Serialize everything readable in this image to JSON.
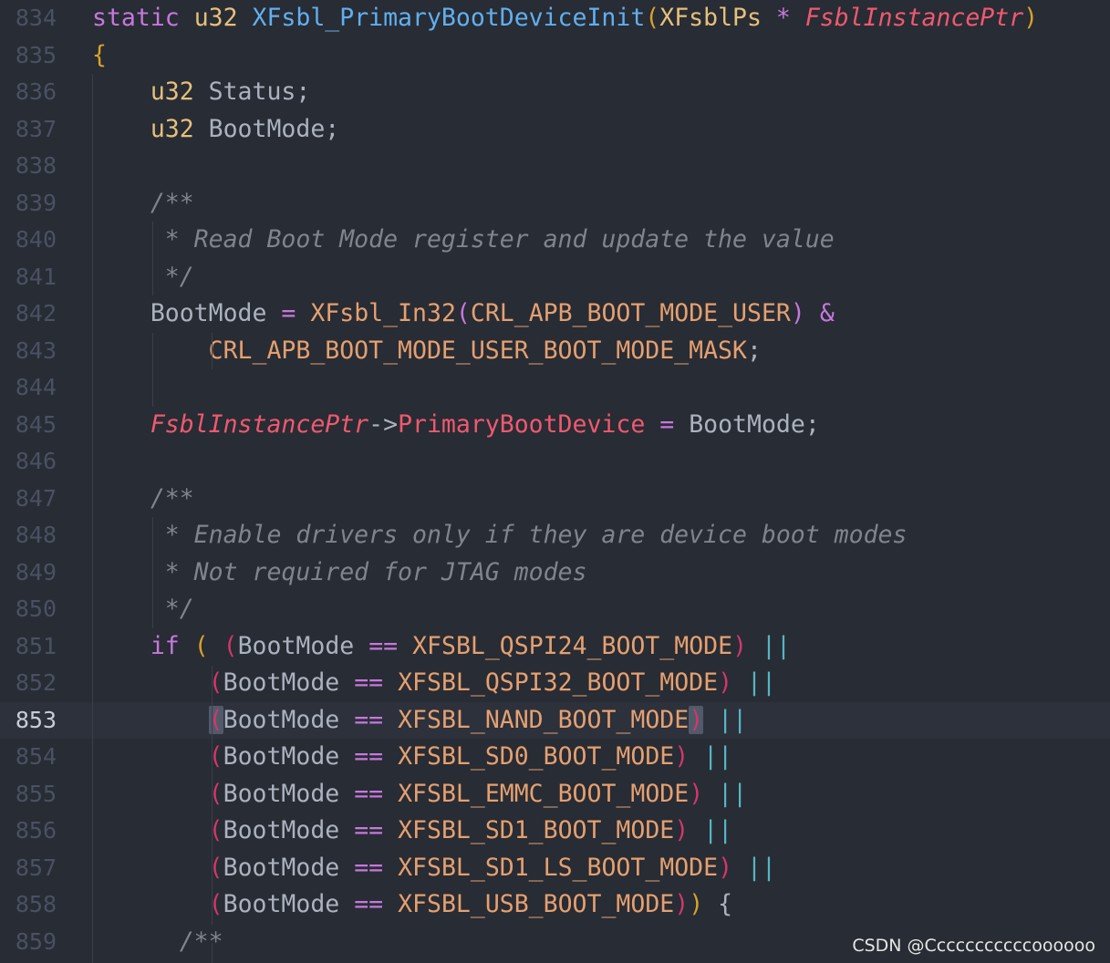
{
  "editor": {
    "active_line": "853",
    "lines": [
      {
        "num": "834",
        "tokens": [
          {
            "t": "static ",
            "c": "kw"
          },
          {
            "t": "u32 ",
            "c": "ty"
          },
          {
            "t": "XFsbl_PrimaryBootDeviceInit",
            "c": "fn"
          },
          {
            "t": "(",
            "c": "p1"
          },
          {
            "t": "XFsblPs",
            "c": "ty"
          },
          {
            "t": " * ",
            "c": "kw"
          },
          {
            "t": "FsblInstancePtr",
            "c": "param"
          },
          {
            "t": ")",
            "c": "p1"
          }
        ]
      },
      {
        "num": "835",
        "tokens": [
          {
            "t": "{",
            "c": "p1"
          }
        ]
      },
      {
        "num": "836",
        "tokens": [
          {
            "t": "    u32 ",
            "c": "ty"
          },
          {
            "t": "Status;",
            "c": "pl"
          }
        ]
      },
      {
        "num": "837",
        "tokens": [
          {
            "t": "    u32 ",
            "c": "ty"
          },
          {
            "t": "BootMode;",
            "c": "pl"
          }
        ]
      },
      {
        "num": "838",
        "tokens": []
      },
      {
        "num": "839",
        "tokens": [
          {
            "t": "    /**",
            "c": "cm"
          }
        ]
      },
      {
        "num": "840",
        "tokens": [
          {
            "t": "     * Read Boot Mode register and update the value",
            "c": "cm"
          }
        ]
      },
      {
        "num": "841",
        "tokens": [
          {
            "t": "     */",
            "c": "cm"
          }
        ]
      },
      {
        "num": "842",
        "tokens": [
          {
            "t": "    BootMode ",
            "c": "pl"
          },
          {
            "t": "=",
            "c": "op"
          },
          {
            "t": " ",
            "c": "pl"
          },
          {
            "t": "XFsbl_In32",
            "c": "mac"
          },
          {
            "t": "(",
            "c": "p2"
          },
          {
            "t": "CRL_APB_BOOT_MODE_USER",
            "c": "mac"
          },
          {
            "t": ")",
            "c": "p2"
          },
          {
            "t": " ",
            "c": "pl"
          },
          {
            "t": "&",
            "c": "op"
          }
        ]
      },
      {
        "num": "843",
        "tokens": [
          {
            "t": "        CRL_APB_BOOT_MODE_USER_BOOT_MODE_MASK",
            "c": "mac"
          },
          {
            "t": ";",
            "c": "pl"
          }
        ]
      },
      {
        "num": "844",
        "tokens": []
      },
      {
        "num": "845",
        "tokens": [
          {
            "t": "    FsblInstancePtr",
            "c": "param"
          },
          {
            "t": "->",
            "c": "pl"
          },
          {
            "t": "PrimaryBootDevice",
            "c": "mem"
          },
          {
            "t": " ",
            "c": "pl"
          },
          {
            "t": "=",
            "c": "op"
          },
          {
            "t": " BootMode;",
            "c": "pl"
          }
        ]
      },
      {
        "num": "846",
        "tokens": []
      },
      {
        "num": "847",
        "tokens": [
          {
            "t": "    /**",
            "c": "cm"
          }
        ]
      },
      {
        "num": "848",
        "tokens": [
          {
            "t": "     * Enable drivers only if they are device boot modes",
            "c": "cm"
          }
        ]
      },
      {
        "num": "849",
        "tokens": [
          {
            "t": "     * Not required for JTAG modes",
            "c": "cm"
          }
        ]
      },
      {
        "num": "850",
        "tokens": [
          {
            "t": "     */",
            "c": "cm"
          }
        ]
      },
      {
        "num": "851",
        "tokens": [
          {
            "t": "    if ",
            "c": "kw"
          },
          {
            "t": "(",
            "c": "p1"
          },
          {
            "t": " ",
            "c": "pl"
          },
          {
            "t": "(",
            "c": "p3"
          },
          {
            "t": "BootMode ",
            "c": "pl"
          },
          {
            "t": "==",
            "c": "op"
          },
          {
            "t": " ",
            "c": "pl"
          },
          {
            "t": "XFSBL_QSPI24_BOOT_MODE",
            "c": "mac"
          },
          {
            "t": ")",
            "c": "p3"
          },
          {
            "t": " ",
            "c": "pl"
          },
          {
            "t": "||",
            "c": "op2"
          }
        ]
      },
      {
        "num": "852",
        "tokens": [
          {
            "t": "        ",
            "c": "pl"
          },
          {
            "t": "(",
            "c": "p3"
          },
          {
            "t": "BootMode ",
            "c": "pl"
          },
          {
            "t": "==",
            "c": "op"
          },
          {
            "t": " ",
            "c": "pl"
          },
          {
            "t": "XFSBL_QSPI32_BOOT_MODE",
            "c": "mac"
          },
          {
            "t": ")",
            "c": "p3"
          },
          {
            "t": " ",
            "c": "pl"
          },
          {
            "t": "||",
            "c": "op2"
          }
        ]
      },
      {
        "num": "853",
        "tokens": [
          {
            "t": "        ",
            "c": "pl"
          },
          {
            "t": "(",
            "c": "p3 match"
          },
          {
            "t": "BootMode ",
            "c": "pl"
          },
          {
            "t": "==",
            "c": "op"
          },
          {
            "t": " ",
            "c": "pl"
          },
          {
            "t": "XFSBL_NAND_BOOT_MODE",
            "c": "mac"
          },
          {
            "t": ")",
            "c": "p3 match"
          },
          {
            "t": " ",
            "c": "pl"
          },
          {
            "t": "||",
            "c": "op2"
          }
        ]
      },
      {
        "num": "854",
        "tokens": [
          {
            "t": "        ",
            "c": "pl"
          },
          {
            "t": "(",
            "c": "p3"
          },
          {
            "t": "BootMode ",
            "c": "pl"
          },
          {
            "t": "==",
            "c": "op"
          },
          {
            "t": " ",
            "c": "pl"
          },
          {
            "t": "XFSBL_SD0_BOOT_MODE",
            "c": "mac"
          },
          {
            "t": ")",
            "c": "p3"
          },
          {
            "t": " ",
            "c": "pl"
          },
          {
            "t": "||",
            "c": "op2"
          }
        ]
      },
      {
        "num": "855",
        "tokens": [
          {
            "t": "        ",
            "c": "pl"
          },
          {
            "t": "(",
            "c": "p3"
          },
          {
            "t": "BootMode ",
            "c": "pl"
          },
          {
            "t": "==",
            "c": "op"
          },
          {
            "t": " ",
            "c": "pl"
          },
          {
            "t": "XFSBL_EMMC_BOOT_MODE",
            "c": "mac"
          },
          {
            "t": ")",
            "c": "p3"
          },
          {
            "t": " ",
            "c": "pl"
          },
          {
            "t": "||",
            "c": "op2"
          }
        ]
      },
      {
        "num": "856",
        "tokens": [
          {
            "t": "        ",
            "c": "pl"
          },
          {
            "t": "(",
            "c": "p3"
          },
          {
            "t": "BootMode ",
            "c": "pl"
          },
          {
            "t": "==",
            "c": "op"
          },
          {
            "t": " ",
            "c": "pl"
          },
          {
            "t": "XFSBL_SD1_BOOT_MODE",
            "c": "mac"
          },
          {
            "t": ")",
            "c": "p3"
          },
          {
            "t": " ",
            "c": "pl"
          },
          {
            "t": "||",
            "c": "op2"
          }
        ]
      },
      {
        "num": "857",
        "tokens": [
          {
            "t": "        ",
            "c": "pl"
          },
          {
            "t": "(",
            "c": "p3"
          },
          {
            "t": "BootMode ",
            "c": "pl"
          },
          {
            "t": "==",
            "c": "op"
          },
          {
            "t": " ",
            "c": "pl"
          },
          {
            "t": "XFSBL_SD1_LS_BOOT_MODE",
            "c": "mac"
          },
          {
            "t": ")",
            "c": "p3"
          },
          {
            "t": " ",
            "c": "pl"
          },
          {
            "t": "||",
            "c": "op2"
          }
        ]
      },
      {
        "num": "858",
        "tokens": [
          {
            "t": "        ",
            "c": "pl"
          },
          {
            "t": "(",
            "c": "p3"
          },
          {
            "t": "BootMode ",
            "c": "pl"
          },
          {
            "t": "==",
            "c": "op"
          },
          {
            "t": " ",
            "c": "pl"
          },
          {
            "t": "XFSBL_USB_BOOT_MODE",
            "c": "mac"
          },
          {
            "t": ")",
            "c": "p3"
          },
          {
            "t": ")",
            "c": "p1"
          },
          {
            "t": " ",
            "c": "pl"
          },
          {
            "t": "{",
            "c": "pl"
          }
        ]
      },
      {
        "num": "859",
        "tokens": [
          {
            "t": "      /**",
            "c": "cm"
          }
        ]
      }
    ]
  },
  "watermark": "CSDN @Cccccccccccoooooo"
}
